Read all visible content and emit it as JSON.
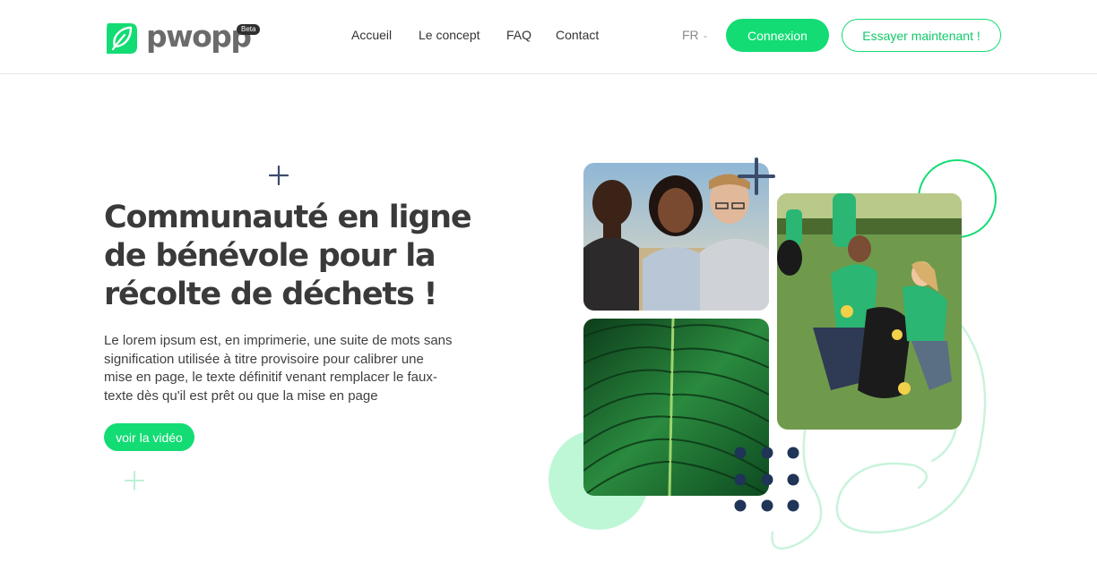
{
  "brand": {
    "name": "pwopp",
    "badge": "Beta"
  },
  "nav": {
    "items": [
      {
        "label": "Accueil"
      },
      {
        "label": "Le concept"
      },
      {
        "label": "FAQ"
      },
      {
        "label": "Contact"
      }
    ]
  },
  "header": {
    "language": "FR",
    "login_label": "Connexion",
    "try_label": "Essayer maintenant !"
  },
  "hero": {
    "title_line1": "Communauté en ligne",
    "title_line2": "de bénévole pour la",
    "title_line3": "récolte de déchets !",
    "body": "Le lorem ipsum est, en imprimerie, une suite de mots sans signification utilisée à titre provisoire pour calibrer une mise en page, le texte définitif venant remplacer le faux-texte dès qu'il est prêt ou que la mise en page",
    "video_label": "voir la vidéo"
  },
  "colors": {
    "accent": "#13dc74",
    "light_accent": "#bdf7d6",
    "navy": "#1f3457",
    "text": "#3a3a3a"
  },
  "icons": {
    "logo": "leaf-logo-icon",
    "plus": "plus-icon",
    "dots": "dot-grid-icon"
  }
}
